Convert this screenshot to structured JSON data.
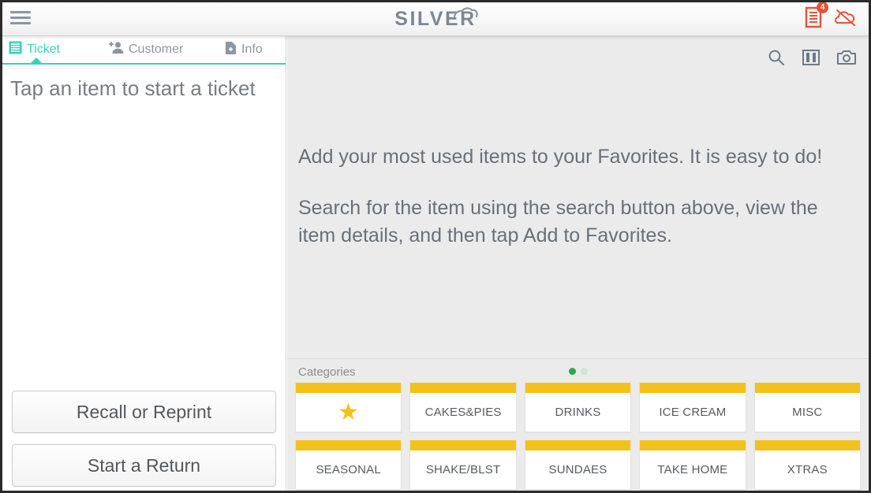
{
  "header": {
    "menu_icon": "hamburger-menu-icon",
    "logo_text": "SILVER",
    "logo_mark": "cloud-icon",
    "receipt_icon": "receipt-icon",
    "receipt_badge": "4",
    "cloud_off_icon": "cloud-offline-icon",
    "accent_red": "#e8503a",
    "logo_color": "#7b8794"
  },
  "left_panel": {
    "tabs": [
      {
        "label": "Ticket",
        "icon": "ticket-icon",
        "active": true
      },
      {
        "label": "Customer",
        "icon": "add-person-icon",
        "active": false
      },
      {
        "label": "Info",
        "icon": "add-document-icon",
        "active": false
      }
    ],
    "active_color": "#3ccfc0",
    "hint": "Tap an item to start a ticket",
    "buttons": [
      {
        "label": "Recall or Reprint"
      },
      {
        "label": "Start a Return"
      }
    ]
  },
  "right_panel": {
    "toolbar": [
      {
        "icon": "search-icon"
      },
      {
        "icon": "columns-view-icon"
      },
      {
        "icon": "camera-icon"
      }
    ],
    "paragraphs": [
      "Add your most used items to your Favorites. It is easy to do!",
      "Search for the item using the search button above, view the item details, and then tap Add to Favorites."
    ],
    "categories": {
      "title": "Categories",
      "pager": {
        "total": 2,
        "active_index": 0,
        "active_color": "#2ca84f",
        "inactive_color": "#cfe6d6"
      },
      "strip_color": "#f2c21b",
      "tiles": [
        {
          "label": "",
          "icon": "star-icon"
        },
        {
          "label": "CAKES&PIES",
          "icon": ""
        },
        {
          "label": "DRINKS",
          "icon": ""
        },
        {
          "label": "ICE CREAM",
          "icon": ""
        },
        {
          "label": "MISC",
          "icon": ""
        },
        {
          "label": "SEASONAL",
          "icon": ""
        },
        {
          "label": "SHAKE/BLST",
          "icon": ""
        },
        {
          "label": "SUNDAES",
          "icon": ""
        },
        {
          "label": "TAKE HOME",
          "icon": ""
        },
        {
          "label": "XTRAS",
          "icon": ""
        }
      ]
    }
  }
}
